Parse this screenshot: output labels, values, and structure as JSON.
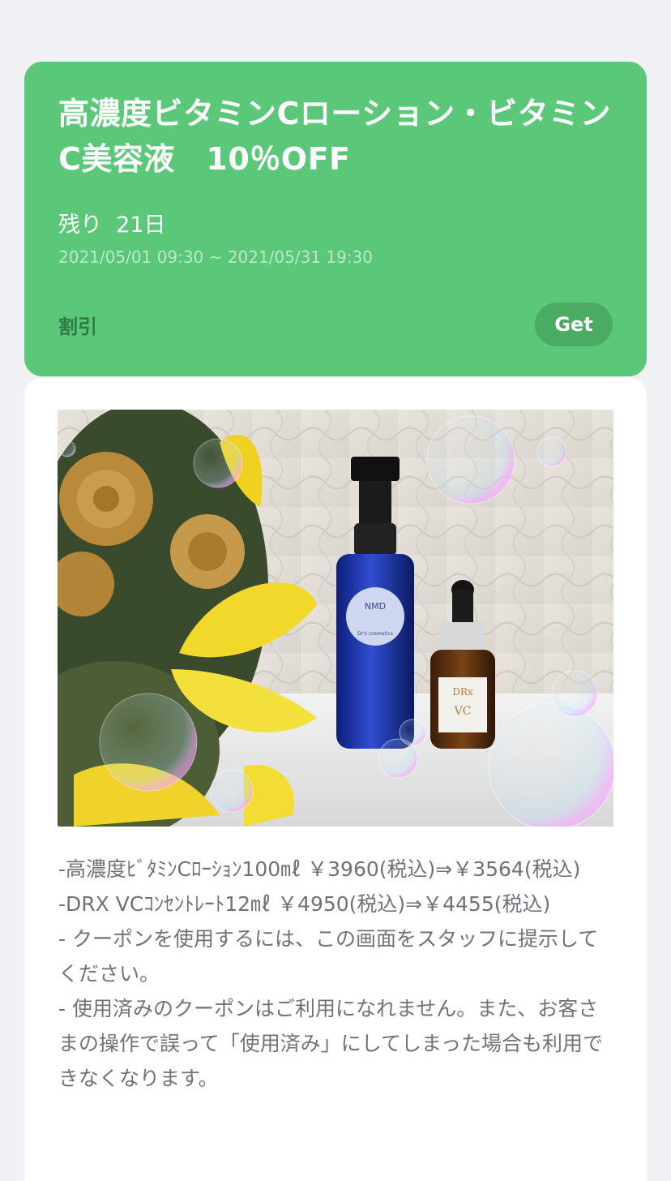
{
  "coupon": {
    "title": "高濃度ビタミンCローション・ビタミンC美容液　10％OFF",
    "remaining_label": "残り",
    "remaining_days": "21日",
    "period": "2021/05/01 09:30 ~ 2021/05/31 19:30",
    "category": "割引",
    "get_label": "Get"
  },
  "image": {
    "bottle_label_1": "NMD",
    "bottle_label_2": "Dr's cosmetics",
    "dropper_label_1": "DRx",
    "dropper_label_2": "VC"
  },
  "description": [
    "-高濃度ﾋﾞﾀﾐﾝCﾛｰｼｮﾝ100㎖ ￥3960(税込)⇒￥3564(税込)",
    "-DRX VCｺﾝｾﾝﾄﾚｰﾄ12㎖ ￥4950(税込)⇒￥4455(税込)",
    "- クーポンを使用するには、この画面をスタッフに提示してください。",
    "- 使用済みのクーポンはご利用になれません。また、お客さまの操作で誤って「使用済み」にしてしまった場合も利用できなくなります。"
  ],
  "colors": {
    "card_green": "#5ac878",
    "button_green": "#4aac63",
    "category_text": "#2f7a45",
    "background": "#eff1f4"
  }
}
